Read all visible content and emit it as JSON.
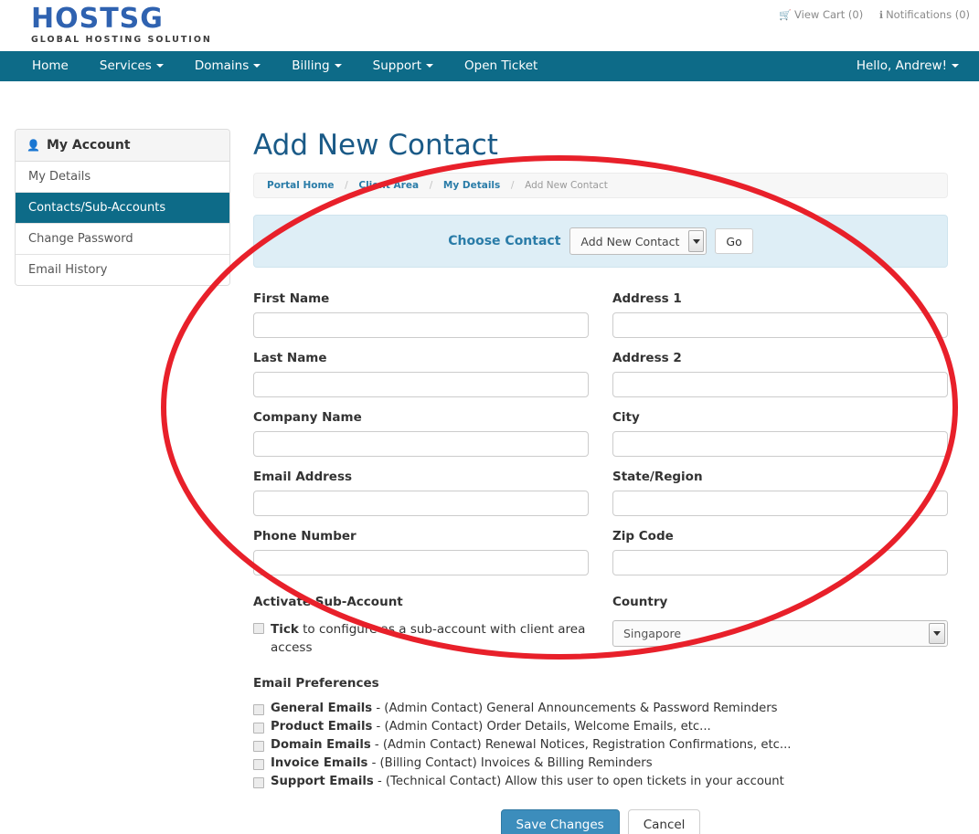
{
  "header": {
    "logo_main": "HOSTSG",
    "logo_sub": "GLOBAL HOSTING SOLUTION",
    "cart_icon": "shopping-cart-icon",
    "cart_label": "View Cart (0)",
    "notifications_icon": "info-icon",
    "notifications_label": "Notifications (0)"
  },
  "nav": {
    "items": [
      {
        "label": "Home",
        "has_caret": false
      },
      {
        "label": "Services",
        "has_caret": true
      },
      {
        "label": "Domains",
        "has_caret": true
      },
      {
        "label": "Billing",
        "has_caret": true
      },
      {
        "label": "Support",
        "has_caret": true
      },
      {
        "label": "Open Ticket",
        "has_caret": false
      }
    ],
    "user_greeting": "Hello, Andrew!"
  },
  "sidebar": {
    "heading": "My Account",
    "heading_icon": "user-icon",
    "items": [
      {
        "label": "My Details",
        "active": false
      },
      {
        "label": "Contacts/Sub-Accounts",
        "active": true
      },
      {
        "label": "Change Password",
        "active": false
      },
      {
        "label": "Email History",
        "active": false
      }
    ]
  },
  "main": {
    "page_title": "Add New Contact",
    "breadcrumb": [
      {
        "label": "Portal Home",
        "current": false
      },
      {
        "label": "Client Area",
        "current": false
      },
      {
        "label": "My Details",
        "current": false
      },
      {
        "label": "Add New Contact",
        "current": true
      }
    ],
    "breadcrumb_separator": "/",
    "choose_contact": {
      "label": "Choose Contact",
      "selected": "Add New Contact",
      "options": [
        "Add New Contact"
      ],
      "go_label": "Go"
    },
    "form": {
      "left_fields": [
        {
          "label": "First Name",
          "value": "",
          "placeholder": ""
        },
        {
          "label": "Last Name",
          "value": "",
          "placeholder": ""
        },
        {
          "label": "Company Name",
          "value": "",
          "placeholder": ""
        },
        {
          "label": "Email Address",
          "value": "",
          "placeholder": ""
        },
        {
          "label": "Phone Number",
          "value": "",
          "placeholder": ""
        }
      ],
      "right_fields": [
        {
          "label": "Address 1",
          "value": "",
          "placeholder": ""
        },
        {
          "label": "Address 2",
          "value": "",
          "placeholder": ""
        },
        {
          "label": "City",
          "value": "",
          "placeholder": ""
        },
        {
          "label": "State/Region",
          "value": "",
          "placeholder": ""
        },
        {
          "label": "Zip Code",
          "value": "",
          "placeholder": ""
        }
      ],
      "country": {
        "label": "Country",
        "selected": "Singapore",
        "options": [
          "Singapore"
        ]
      },
      "sub_account": {
        "heading": "Activate Sub-Account",
        "checkbox_bold": "Tick",
        "checkbox_text": " to configure as a sub-account with client area access",
        "checked": false
      },
      "email_preferences": {
        "heading": "Email Preferences",
        "items": [
          {
            "bold": "General Emails",
            "rest": " - (Admin Contact) General Announcements & Password Reminders",
            "checked": false
          },
          {
            "bold": "Product Emails",
            "rest": " - (Admin Contact) Order Details, Welcome Emails, etc...",
            "checked": false
          },
          {
            "bold": "Domain Emails",
            "rest": " - (Admin Contact) Renewal Notices, Registration Confirmations, etc...",
            "checked": false
          },
          {
            "bold": "Invoice Emails",
            "rest": " - (Billing Contact) Invoices & Billing Reminders",
            "checked": false
          },
          {
            "bold": "Support Emails",
            "rest": " - (Technical Contact) Allow this user to open tickets in your account",
            "checked": false
          }
        ]
      },
      "save_label": "Save Changes",
      "cancel_label": "Cancel"
    }
  },
  "annotation": {
    "shape": "ellipse",
    "color": "#e8202a",
    "stroke_width": 6
  },
  "colors": {
    "nav_bg": "#0d6b88",
    "accent": "#2a7ca8",
    "title": "#1a5a87",
    "panel_bg": "#deeef6",
    "primary_button": "#3c8dbc",
    "logo": "#2f62b0",
    "annotation": "#e8202a"
  }
}
